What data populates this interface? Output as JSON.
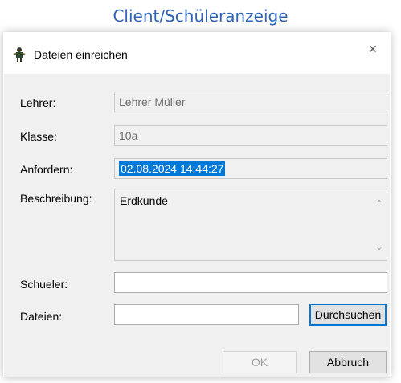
{
  "caption": "Client/Schüleranzeige",
  "dialog": {
    "title": "Dateien einreichen",
    "close_symbol": "×",
    "app_icon": "teacher-figure-icon"
  },
  "form": {
    "teacher_label": "Lehrer:",
    "teacher_value": "Lehrer Müller",
    "class_label": "Klasse:",
    "class_value": "10a",
    "request_label": "Anfordern:",
    "request_value": "02.08.2024 14:44:27",
    "description_label": "Beschreibung:",
    "description_value": "Erdkunde",
    "student_label": "Schueler:",
    "student_value": "",
    "files_label": "Dateien:",
    "files_value": ""
  },
  "buttons": {
    "browse": "Durchsuchen",
    "ok": "OK",
    "cancel": "Abbruch"
  },
  "colors": {
    "caption": "#2e63b8",
    "selection": "#0078d7",
    "dialog_bg": "#f0f0f0"
  }
}
